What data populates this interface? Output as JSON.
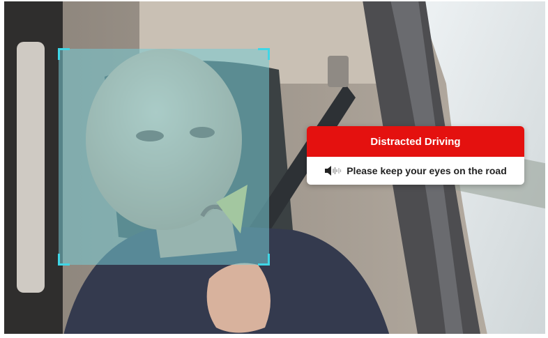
{
  "alert": {
    "title": "Distracted Driving",
    "message": "Please keep your eyes on the road",
    "icon": "speaker-sound-icon",
    "header_color": "#e4110f"
  },
  "detection": {
    "icon": "face-detection-box",
    "overlay_color": "#76cbd4",
    "corner_color": "#3fd6e6"
  }
}
